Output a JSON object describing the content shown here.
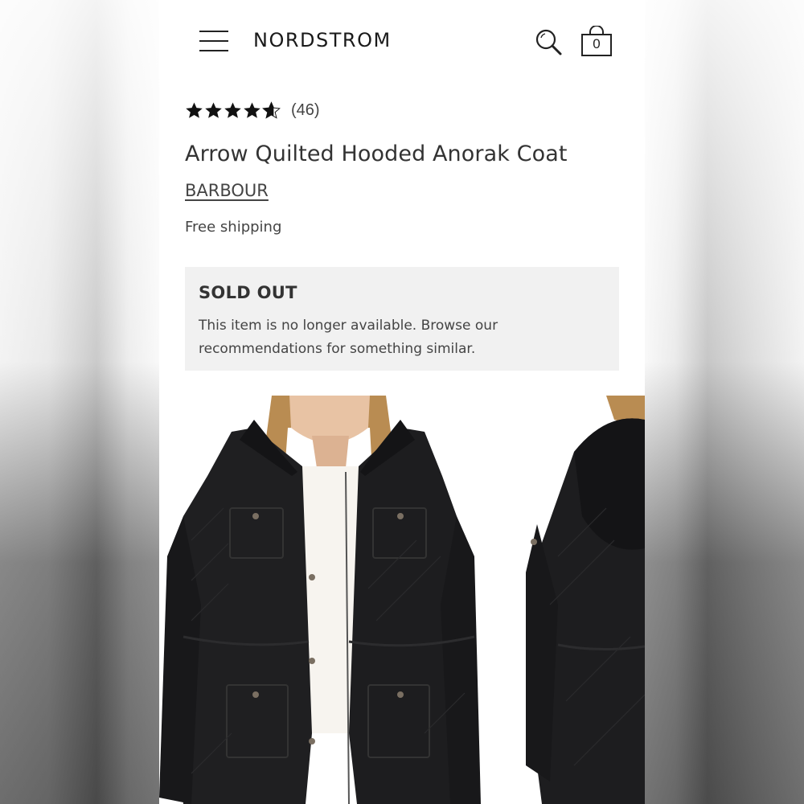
{
  "header": {
    "logo": "NORDSTROM",
    "bag_count": "0",
    "icons": [
      "menu-icon",
      "search-icon",
      "shopping-bag-icon"
    ]
  },
  "product": {
    "rating_stars": 4.5,
    "review_count": "(46)",
    "title": "Arrow Quilted Hooded Anorak Coat",
    "brand": "BARBOUR",
    "shipping": "Free shipping"
  },
  "availability": {
    "status": "SOLD OUT",
    "message": "This item is no longer available. Browse our recommendations for something similar."
  },
  "gallery": {
    "images": [
      "front-view",
      "back-view"
    ]
  },
  "colors": {
    "text_primary": "#333333",
    "soldout_bg": "#f1f1f1",
    "page_bg": "#ffffff",
    "jacket": "#1e1e1e"
  }
}
